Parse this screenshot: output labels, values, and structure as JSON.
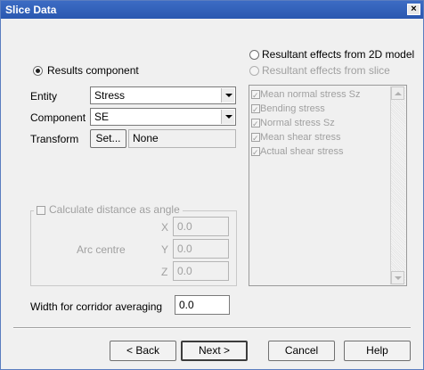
{
  "window": {
    "title": "Slice Data",
    "close_glyph": "×"
  },
  "results_component": {
    "label": "Results component",
    "selected": true
  },
  "resultant_2d": {
    "label": "Resultant effects from 2D model",
    "selected": false
  },
  "resultant_slice": {
    "label": "Resultant effects from slice",
    "enabled": false
  },
  "entity": {
    "label": "Entity",
    "value": "Stress"
  },
  "component": {
    "label": "Component",
    "value": "SE"
  },
  "transform": {
    "label": "Transform",
    "button": "Set...",
    "value": "None"
  },
  "effects_list": {
    "items": [
      {
        "label": "Mean normal stress Sz",
        "checked": true
      },
      {
        "label": "Bending stress",
        "checked": true
      },
      {
        "label": "Normal stress Sz",
        "checked": true
      },
      {
        "label": "Mean shear stress",
        "checked": true
      },
      {
        "label": "Actual shear stress",
        "checked": true
      }
    ]
  },
  "angle_group": {
    "checkbox_label": "Calculate distance as angle",
    "arc_centre_label": "Arc centre",
    "x_label": "X",
    "x_value": "0.0",
    "y_label": "Y",
    "y_value": "0.0",
    "z_label": "Z",
    "z_value": "0.0"
  },
  "corridor": {
    "label": "Width for corridor averaging",
    "value": "0.0"
  },
  "buttons": {
    "back": "< Back",
    "next": "Next >",
    "cancel": "Cancel",
    "help": "Help"
  }
}
